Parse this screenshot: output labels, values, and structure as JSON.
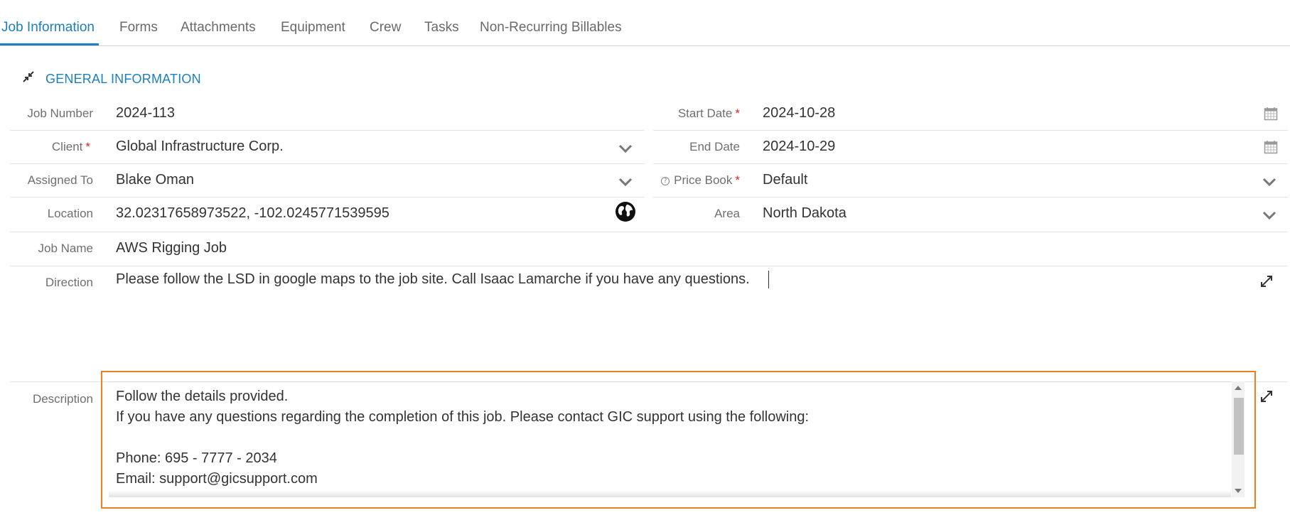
{
  "tabs": [
    {
      "label": "Job Information",
      "active": true
    },
    {
      "label": "Forms"
    },
    {
      "label": "Attachments"
    },
    {
      "label": "Equipment"
    },
    {
      "label": "Crew"
    },
    {
      "label": "Tasks"
    },
    {
      "label": "Non-Recurring Billables"
    }
  ],
  "section": {
    "title": "GENERAL INFORMATION",
    "collapse_icon": "collapse-arrows-icon"
  },
  "fields": {
    "job_number": {
      "label": "Job Number",
      "value": "2024-113"
    },
    "client": {
      "label": "Client",
      "required": "*",
      "value": "Global Infrastructure Corp."
    },
    "assigned_to": {
      "label": "Assigned To",
      "value": "Blake Oman"
    },
    "location": {
      "label": "Location",
      "value": "32.02317658973522, -102.0245771539595",
      "icon": "globe-icon"
    },
    "start_date": {
      "label": "Start Date",
      "required": "*",
      "value": "2024-10-28",
      "icon": "calendar-icon"
    },
    "end_date": {
      "label": "End Date",
      "value": "2024-10-29",
      "icon": "calendar-icon"
    },
    "price_book": {
      "label": "Price Book",
      "required": "*",
      "value": "Default",
      "help_icon": "?"
    },
    "area": {
      "label": "Area",
      "value": "North Dakota"
    },
    "job_name": {
      "label": "Job Name",
      "value": "AWS Rigging Job"
    },
    "direction": {
      "label": "Direction",
      "value": "Please follow the LSD in google maps to the job site. Call Isaac Lamarche if you have any questions."
    },
    "description": {
      "label": "Description",
      "value": "Follow the details provided.\nIf you have any questions regarding the completion of this job. Please contact GIC support using the following:\n\nPhone: 695 - 7777 - 2034\nEmail: support@gicsupport.com"
    }
  },
  "colors": {
    "accent": "#1b7fc3",
    "required": "#d9252b",
    "highlight_frame": "#f07d1e"
  }
}
